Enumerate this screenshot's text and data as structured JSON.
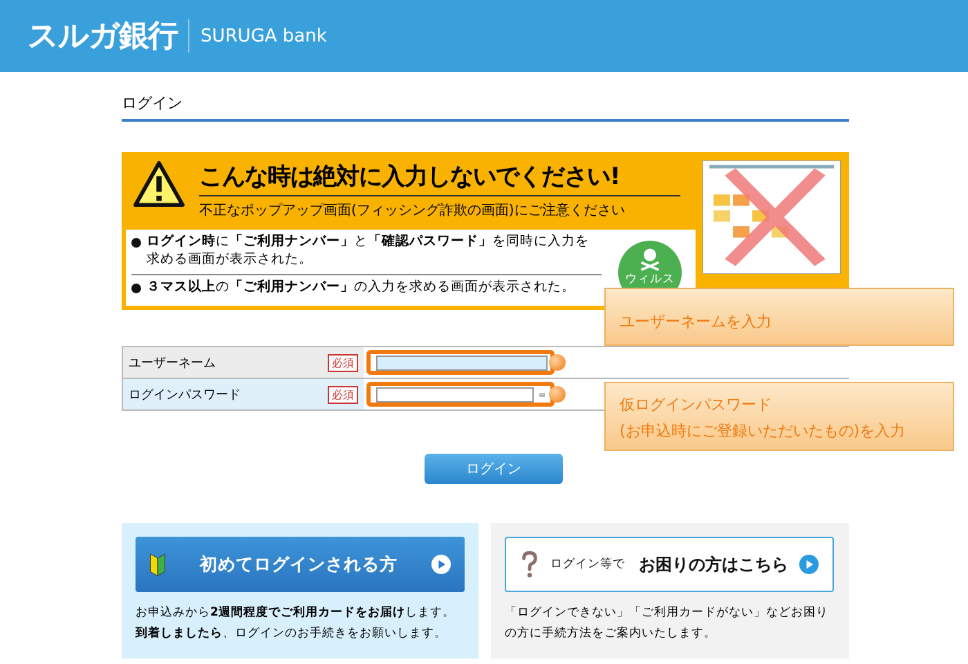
{
  "header": {
    "logo_jp": "スルガ銀行",
    "logo_en": "SURUGA bank"
  },
  "page_title": "ログイン",
  "warning": {
    "headline": "こんな時は絶対に入力しないでください!",
    "subline": "不正なポップアップ画面(フィッシング詐欺の画面)にご注意ください",
    "badge": "ウィルス",
    "items": [
      "**ログイン時**に**「ご利用ナンバー」**と**「確認パスワード」**を同時に入力を求める画面が表示された。",
      "**３マス以上**の**「ご利用ナンバー」**の入力を求める画面が表示された。"
    ]
  },
  "form": {
    "fields": [
      {
        "label": "ユーザーネーム",
        "required": "必須",
        "kind": "text",
        "focused": true
      },
      {
        "label": "ログインパスワード",
        "required": "必須",
        "kind": "password",
        "focused": false
      }
    ]
  },
  "callouts": [
    {
      "lines": [
        "ユーザーネームを入力"
      ]
    },
    {
      "lines": [
        "仮ログインパスワード",
        "(お申込時にご登録いただいたもの)を入力"
      ]
    }
  ],
  "login_button": "ログイン",
  "panels": [
    {
      "kind": "beginner",
      "button": "初めてログインされる方",
      "text": "お申込みから**2週間程度でご利用カードをお届け**します。**到着しましたら**、ログインのお手続きをお願いします。"
    },
    {
      "kind": "help",
      "button_prefix": "ログイン等で",
      "button": "お困りの方はこちら",
      "text": "「ログインできない」「ご利用カードがない」などお困りの方に手続方法をご案内いたします。"
    }
  ]
}
